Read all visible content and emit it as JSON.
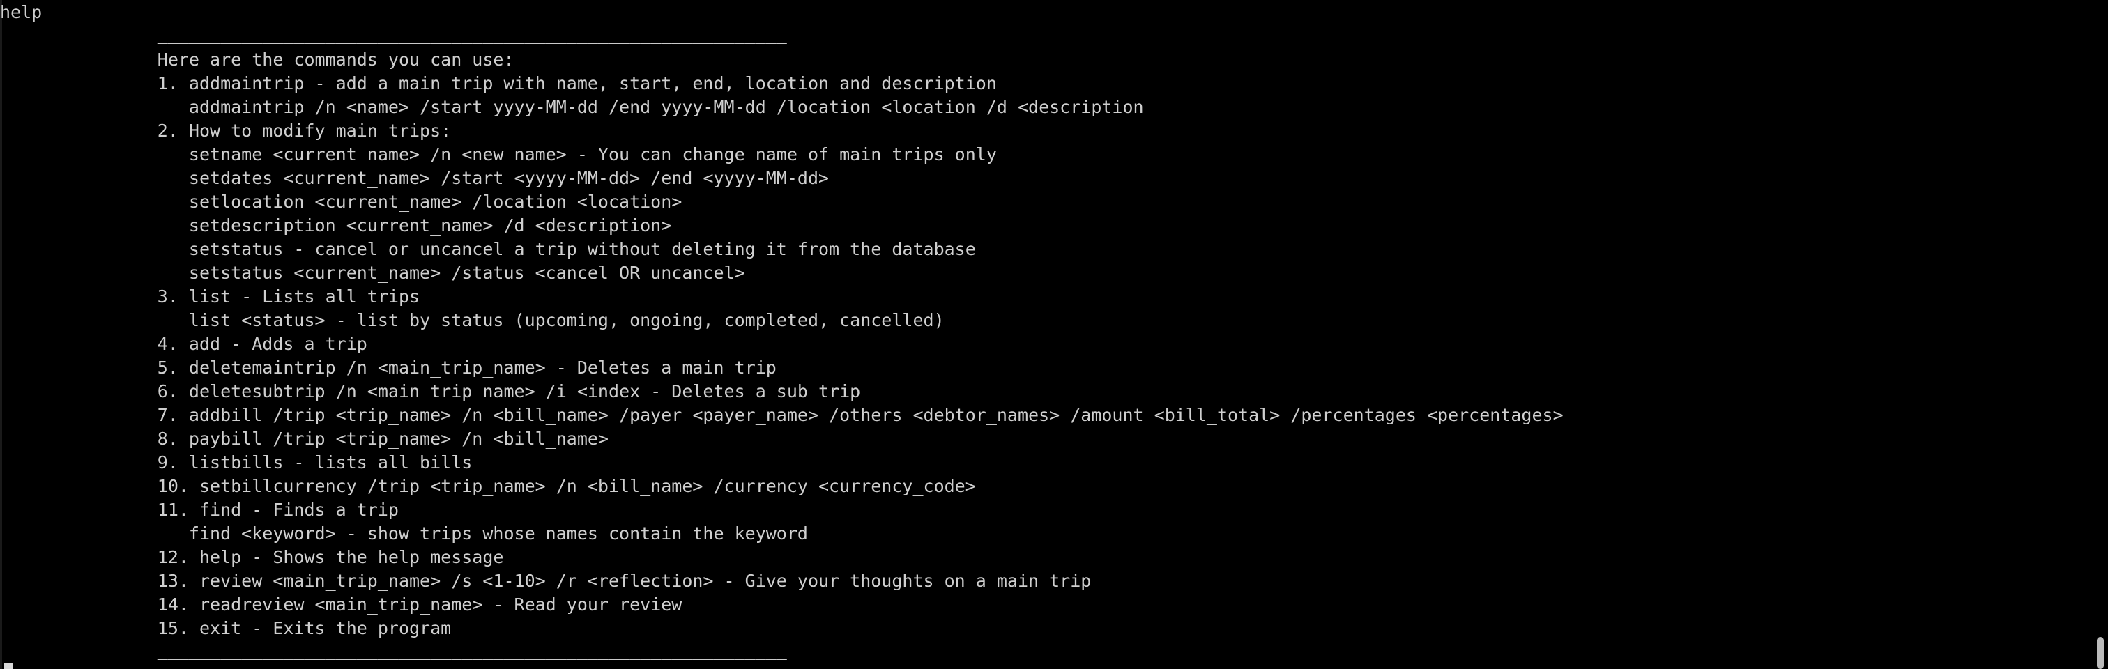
{
  "terminal": {
    "lines": [
      "help",
      "               ____________________________________________________________",
      "               Here are the commands you can use:",
      "               1. addmaintrip - add a main trip with name, start, end, location and description",
      "                  addmaintrip /n <name> /start yyyy-MM-dd /end yyyy-MM-dd /location <location /d <description",
      "               2. How to modify main trips:",
      "                  setname <current_name> /n <new_name> - You can change name of main trips only",
      "                  setdates <current_name> /start <yyyy-MM-dd> /end <yyyy-MM-dd>",
      "                  setlocation <current_name> /location <location>",
      "                  setdescription <current_name> /d <description>",
      "                  setstatus - cancel or uncancel a trip without deleting it from the database",
      "                  setstatus <current_name> /status <cancel OR uncancel>",
      "               3. list - Lists all trips",
      "                  list <status> - list by status (upcoming, ongoing, completed, cancelled)",
      "               4. add - Adds a trip",
      "               5. deletemaintrip /n <main_trip_name> - Deletes a main trip",
      "               6. deletesubtrip /n <main_trip_name> /i <index - Deletes a sub trip",
      "               7. addbill /trip <trip_name> /n <bill_name> /payer <payer_name> /others <debtor_names> /amount <bill_total> /percentages <percentages>",
      "               8. paybill /trip <trip_name> /n <bill_name>",
      "               9. listbills - lists all bills",
      "               10. setbillcurrency /trip <trip_name> /n <bill_name> /currency <currency_code>",
      "               11. find - Finds a trip",
      "                  find <keyword> - show trips whose names contain the keyword",
      "               12. help - Shows the help message",
      "               13. review <main_trip_name> /s <1-10> /r <reflection> - Give your thoughts on a main trip",
      "               14. readreview <main_trip_name> - Read your review",
      "               15. exit - Exits the program",
      "               ____________________________________________________________"
    ]
  }
}
